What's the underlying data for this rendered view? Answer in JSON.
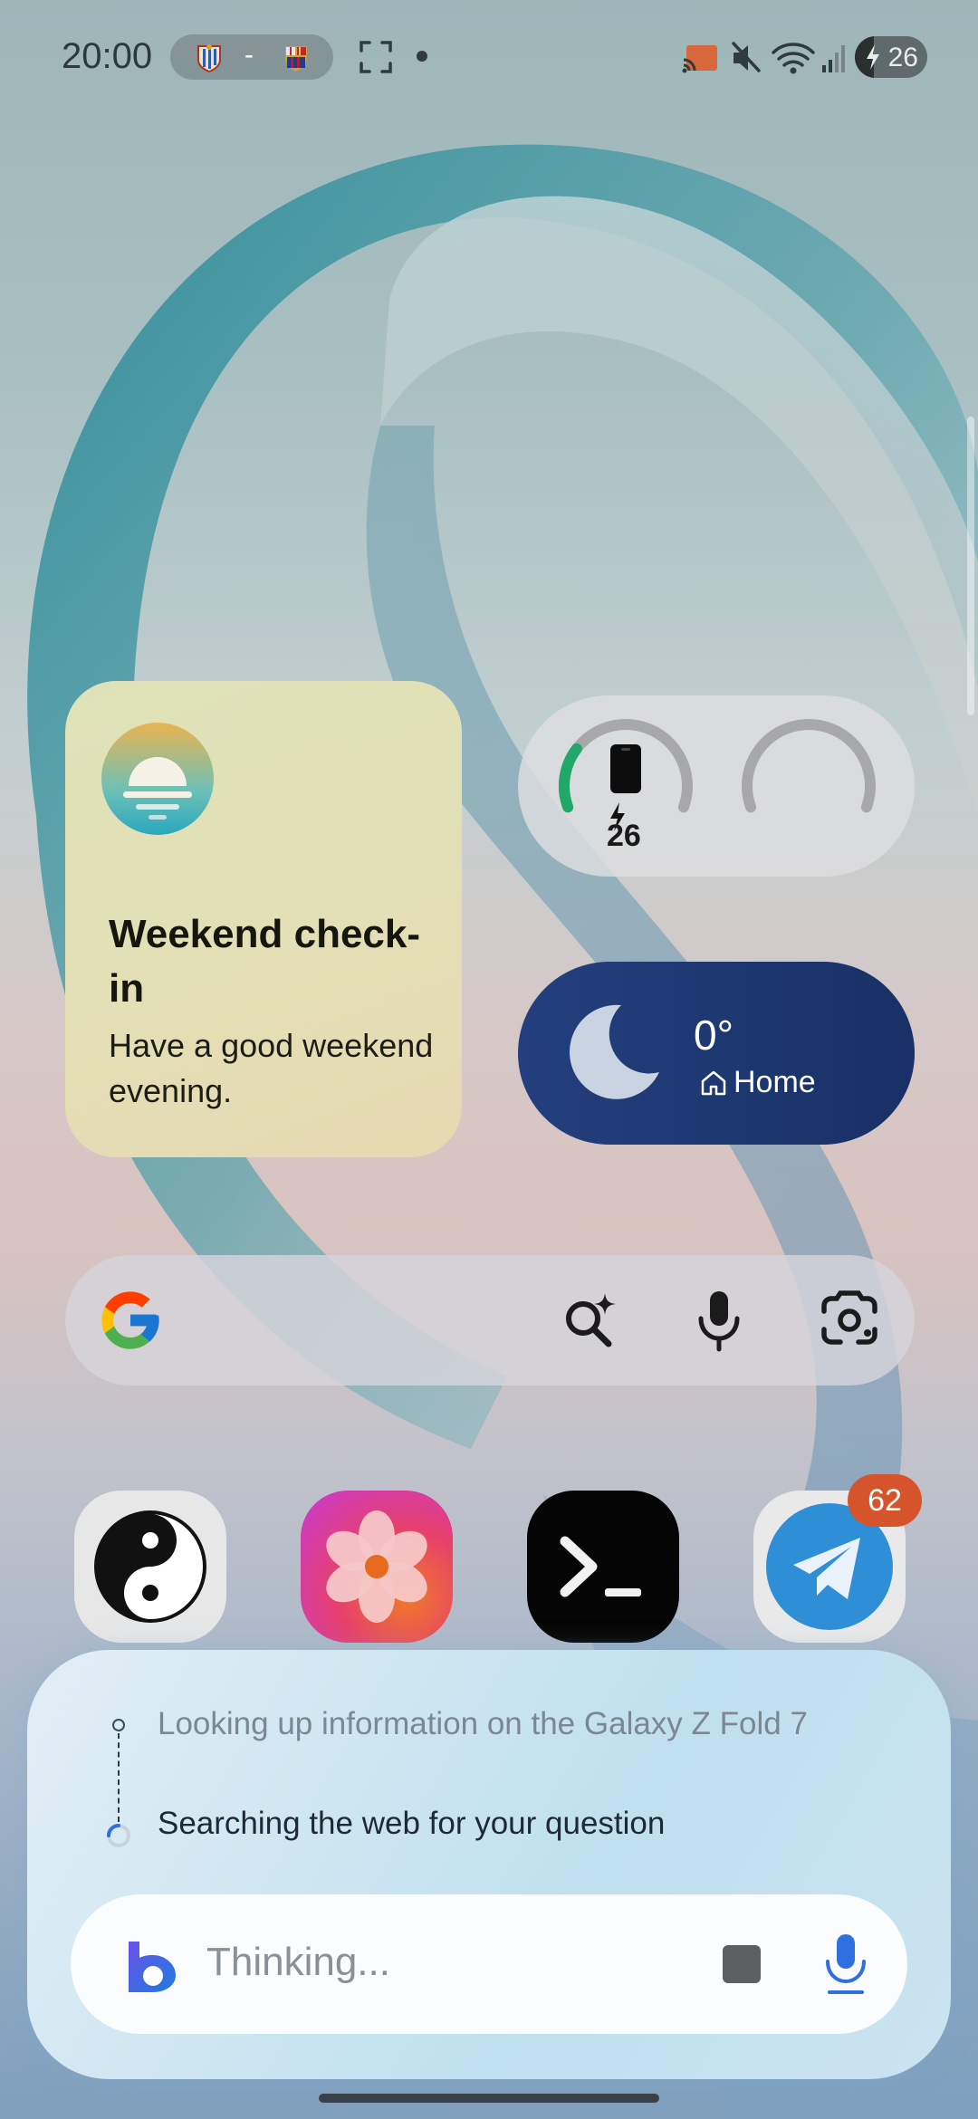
{
  "status_bar": {
    "time": "20:00",
    "live_score": {
      "separator": "-",
      "team_home_icon": "espanyol-crest-icon",
      "team_away_icon": "barcelona-crest-icon"
    },
    "icons": [
      "fullscreen-icon",
      "notification-dot-icon",
      "cast-icon",
      "mute-icon",
      "wifi-icon",
      "signal-icon",
      "battery-charging-icon"
    ],
    "battery_level": "26",
    "battery_fraction": 0.26
  },
  "widgets": {
    "checkin": {
      "icon": "sunset-icon",
      "title": "Weekend check-in",
      "body": "Have a good weekend evening.",
      "colors": {
        "background": "#e0e0b6"
      }
    },
    "battery": {
      "level": "26",
      "level_fraction": 0.26,
      "icons": [
        "phone-icon",
        "charging-bolt-icon"
      ],
      "colors": {
        "arc": "#1fa86a",
        "track": "#a8a8aa"
      }
    },
    "weather": {
      "icon": "moon-icon",
      "temperature": "0°",
      "location": "Home",
      "colors": {
        "background": "#1f3a74"
      }
    }
  },
  "search_bar": {
    "icons": [
      "google-g-icon",
      "ai-search-icon",
      "mic-icon",
      "google-lens-icon"
    ]
  },
  "dock_apps": [
    {
      "icon": "yin-yang-icon"
    },
    {
      "icon": "gallery-flower-icon"
    },
    {
      "icon": "terminal-icon"
    },
    {
      "icon": "telegram-icon",
      "badge": "62"
    }
  ],
  "assistant": {
    "steps": [
      {
        "text": "Looking up information on the Galaxy Z Fold 7",
        "state": "done"
      },
      {
        "text": "Searching the web for your question",
        "state": "in-progress"
      }
    ],
    "input_placeholder": "Thinking...",
    "icons": [
      "bixby-icon",
      "stop-icon",
      "mic-icon"
    ],
    "colors": {
      "accent": "#2f6fe0"
    }
  }
}
